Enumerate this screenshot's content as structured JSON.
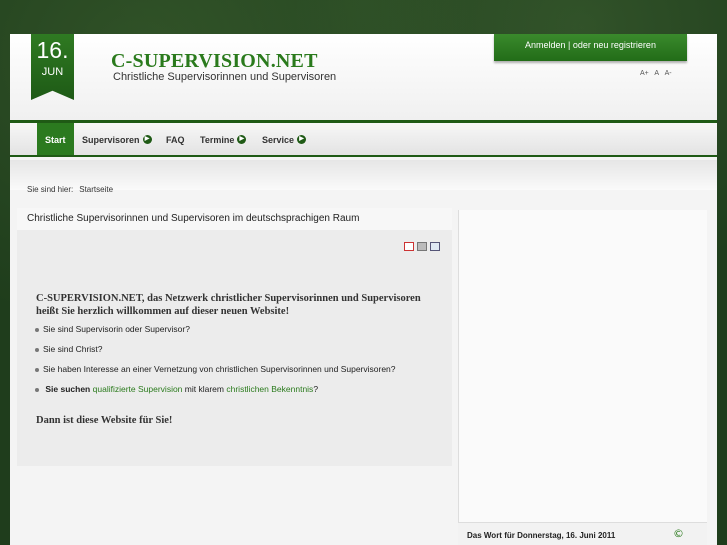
{
  "date": {
    "day": "16.",
    "month": "JUN"
  },
  "site": {
    "title": "C-SUPERVISION.NET",
    "subtitle": "Christliche Supervisorinnen und Supervisoren"
  },
  "login": {
    "text": "Anmelden | oder neu registrieren"
  },
  "font_tools": [
    "A+",
    "A",
    "A-"
  ],
  "nav": [
    {
      "label": "Start",
      "active": true
    },
    {
      "label": "Supervisoren",
      "has_arrow": true
    },
    {
      "label": "FAQ"
    },
    {
      "label": "Termine",
      "has_arrow": true
    },
    {
      "label": "Service",
      "has_arrow": true
    }
  ],
  "breadcrumb": {
    "prefix": "Sie sind hier:",
    "current": "Startseite"
  },
  "content": {
    "title": "Christliche Supervisorinnen und Supervisoren im deutschsprachigen Raum",
    "intro": "C-SUPERVISION.NET,  das Netzwerk christlicher Supervisorinnen und Supervisoren heißt Sie herzlich willkommen auf dieser neuen Website!",
    "bullets": [
      "Sie sind Supervisorin oder Supervisor?",
      "Sie sind Christ?",
      "Sie haben Interesse an einer Vernetzung von christlichen Supervisorinnen und Supervisoren?"
    ],
    "last_bullet": {
      "bold": "Sie suchen",
      "link1": "qualifizierte Supervision",
      "mid": "mit klarem",
      "link2": "christlichen Bekenntnis",
      "end": "?"
    },
    "closing": "Dann ist diese Website für Sie!"
  },
  "sidebar": {
    "word_title": "Das Wort für Donnerstag, 16. Juni 2011",
    "word_icon": "©"
  },
  "colors": {
    "brand_green": "#2a7a1c",
    "dark_green": "#1f5a15"
  }
}
